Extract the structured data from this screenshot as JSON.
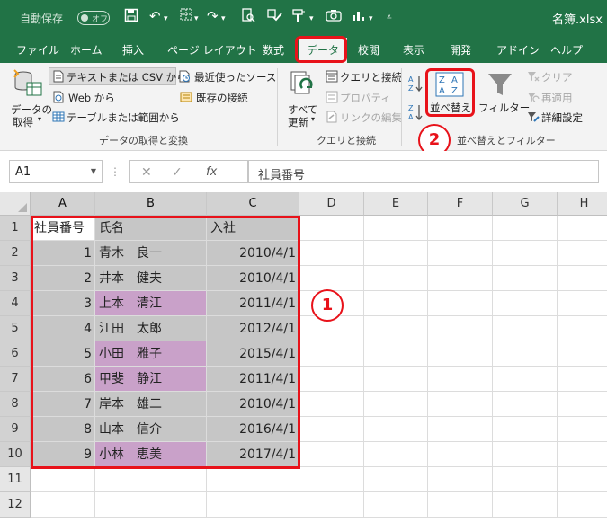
{
  "titlebar": {
    "autosave_label": "自動保存",
    "autosave_toggle": "オフ",
    "filename": "名簿.xlsx"
  },
  "tabs": [
    {
      "label": "ファイル",
      "active": false
    },
    {
      "label": "ホーム",
      "active": false
    },
    {
      "label": "挿入",
      "active": false
    },
    {
      "label": "ページ レイアウト",
      "active": false
    },
    {
      "label": "数式",
      "active": false
    },
    {
      "label": "データ",
      "active": true
    },
    {
      "label": "校閲",
      "active": false
    },
    {
      "label": "表示",
      "active": false
    },
    {
      "label": "開発",
      "active": false
    },
    {
      "label": "アドイン",
      "active": false
    },
    {
      "label": "ヘルプ",
      "active": false
    }
  ],
  "ribbon": {
    "get_data": {
      "main_label_1": "データの",
      "main_label_2": "取得",
      "text_csv": "テキストまたは CSV から",
      "web": "Web から",
      "table_range": "テーブルまたは範囲から",
      "recent_sources": "最近使ったソース",
      "existing_connections": "既存の接続",
      "group_label": "データの取得と変換"
    },
    "queries": {
      "refresh_all_1": "すべて",
      "refresh_all_2": "更新",
      "queries_connections": "クエリと接続",
      "properties": "プロパティ",
      "edit_links": "リンクの編集",
      "group_label": "クエリと接続"
    },
    "sort_filter": {
      "sort": "並べ替え",
      "filter": "フィルター",
      "clear": "クリア",
      "reapply": "再適用",
      "advanced": "詳細設定",
      "group_label": "並べ替えとフィルター"
    }
  },
  "formula_bar": {
    "name_box": "A1",
    "fx_label": "fx",
    "content": "社員番号"
  },
  "sheet": {
    "columns": [
      "A",
      "B",
      "C",
      "D",
      "E",
      "F",
      "G",
      "H"
    ],
    "rows": [
      "1",
      "2",
      "3",
      "4",
      "5",
      "6",
      "7",
      "8",
      "9",
      "10",
      "11",
      "12"
    ],
    "header": {
      "a": "社員番号",
      "b": "氏名",
      "c": "入社"
    },
    "data": [
      {
        "id": "1",
        "name": "青木　良一",
        "date": "2010/4/1",
        "highlight": false
      },
      {
        "id": "2",
        "name": "井本　健夫",
        "date": "2010/4/1",
        "highlight": false
      },
      {
        "id": "3",
        "name": "上本　清江",
        "date": "2011/4/1",
        "highlight": true
      },
      {
        "id": "4",
        "name": "江田　太郎",
        "date": "2012/4/1",
        "highlight": false
      },
      {
        "id": "5",
        "name": "小田　雅子",
        "date": "2015/4/1",
        "highlight": true
      },
      {
        "id": "6",
        "name": "甲斐　静江",
        "date": "2011/4/1",
        "highlight": true
      },
      {
        "id": "7",
        "name": "岸本　雄二",
        "date": "2010/4/1",
        "highlight": false
      },
      {
        "id": "8",
        "name": "山本　信介",
        "date": "2016/4/1",
        "highlight": false
      },
      {
        "id": "9",
        "name": "小林　恵美",
        "date": "2017/4/1",
        "highlight": true
      }
    ]
  },
  "annotations": {
    "step1": "1",
    "step2": "2"
  },
  "colors": {
    "excel_green": "#217346",
    "highlight_pink": "#c9a1c9",
    "selection_grey": "#c6c6c6",
    "annotation_red": "#e8121a"
  }
}
